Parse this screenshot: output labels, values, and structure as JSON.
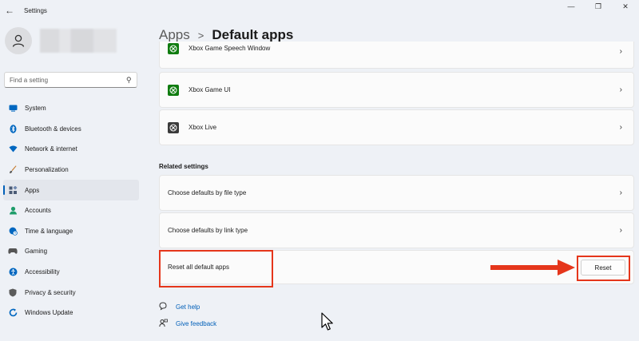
{
  "window": {
    "title": "Settings",
    "back_icon": "back-arrow-icon",
    "controls": [
      "minimize-icon",
      "restore-icon",
      "close-icon"
    ]
  },
  "search": {
    "placeholder": "Find a setting",
    "icon": "search-icon"
  },
  "sidebar": {
    "items": [
      {
        "label": "System",
        "icon": "system-icon",
        "color": "#0067c0",
        "active": false
      },
      {
        "label": "Bluetooth & devices",
        "icon": "bluetooth-icon",
        "color": "#0067c0",
        "active": false
      },
      {
        "label": "Network & internet",
        "icon": "wifi-icon",
        "color": "#0067c0",
        "active": false
      },
      {
        "label": "Personalization",
        "icon": "brush-icon",
        "color": "#c57a2c",
        "active": false
      },
      {
        "label": "Apps",
        "icon": "apps-icon",
        "color": "#4a5a75",
        "active": true
      },
      {
        "label": "Accounts",
        "icon": "accounts-icon",
        "color": "#1f9d6b",
        "active": false
      },
      {
        "label": "Time & language",
        "icon": "globe-clock-icon",
        "color": "#0067c0",
        "active": false
      },
      {
        "label": "Gaming",
        "icon": "gamepad-icon",
        "color": "#555555",
        "active": false
      },
      {
        "label": "Accessibility",
        "icon": "accessibility-icon",
        "color": "#0067c0",
        "active": false
      },
      {
        "label": "Privacy & security",
        "icon": "shield-icon",
        "color": "#5b5b5b",
        "active": false
      },
      {
        "label": "Windows Update",
        "icon": "update-icon",
        "color": "#0067c0",
        "active": false
      }
    ]
  },
  "breadcrumb": {
    "parent": "Apps",
    "separator": ">",
    "current": "Default apps"
  },
  "apps_list": [
    {
      "label": "Xbox Game Speech Window",
      "icon": "xbox-icon"
    },
    {
      "label": "Xbox Game UI",
      "icon": "xbox-icon"
    },
    {
      "label": "Xbox Live",
      "icon": "xbox-live-icon"
    }
  ],
  "related": {
    "title": "Related settings",
    "items": [
      {
        "label": "Choose defaults by file type"
      },
      {
        "label": "Choose defaults by link type"
      }
    ],
    "reset_row": {
      "label": "Reset all default apps",
      "button": "Reset"
    }
  },
  "links": [
    {
      "label": "Get help",
      "icon": "help-icon"
    },
    {
      "label": "Give feedback",
      "icon": "feedback-icon"
    }
  ],
  "accent_color": "#005fb8",
  "highlight_color": "#e5361b"
}
